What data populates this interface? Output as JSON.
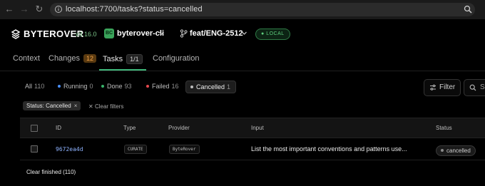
{
  "browser": {
    "url": "localhost:7700/tasks?status=cancelled"
  },
  "header": {
    "brand": "BYTEROVER",
    "version": "v3.16.0",
    "project_badge": "BC",
    "project_name": "byterover-cli",
    "branch": "feat/ENG-2512",
    "mode_badge": "LOCAL"
  },
  "tabs": [
    {
      "label": "Context",
      "count": ""
    },
    {
      "label": "Changes",
      "count": "12"
    },
    {
      "label": "Tasks",
      "count": "1/1"
    },
    {
      "label": "Configuration",
      "count": ""
    }
  ],
  "status_filters": [
    {
      "label": "All",
      "count": "110",
      "dot_color": ""
    },
    {
      "label": "Running",
      "count": "0",
      "dot_color": "#4a90ff"
    },
    {
      "label": "Done",
      "count": "93",
      "dot_color": "#38b36a"
    },
    {
      "label": "Failed",
      "count": "16",
      "dot_color": "#e5484d"
    },
    {
      "label": "Cancelled",
      "count": "1",
      "dot_color": "#bdbdbd"
    }
  ],
  "toolbar": {
    "filter_label": "Filter",
    "search_placeholder": "Se"
  },
  "active_filters": {
    "chip_label": "Status: Cancelled",
    "chip_remove": "×",
    "clear_label": "Clear filters"
  },
  "table": {
    "columns": [
      "ID",
      "Type",
      "Provider",
      "Input",
      "Status"
    ],
    "rows": [
      {
        "id": "9672ea4d",
        "type": "CURATE",
        "provider": "ByteRover",
        "input": "List the most important conventions and patterns use...",
        "status": "cancelled"
      }
    ]
  },
  "footer": {
    "clear_finished": "Clear finished (110)"
  },
  "colors": {
    "accent": "#3fb87a",
    "link": "#8fb3ff",
    "changes_badge": "#f2a24a"
  }
}
